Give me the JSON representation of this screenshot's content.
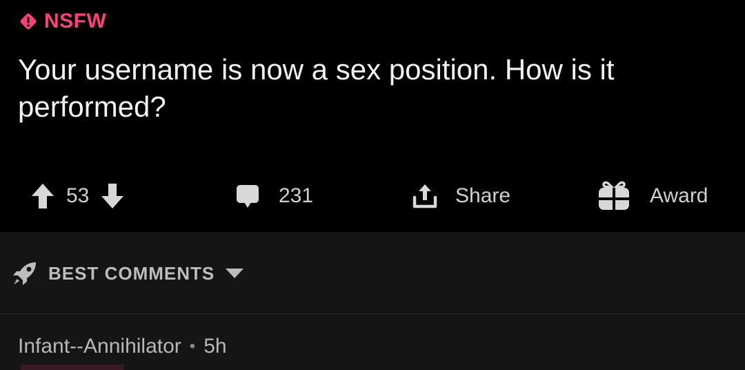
{
  "post": {
    "nsfw_label": "NSFW",
    "title": "Your username is now a sex position. How is it performed?",
    "nsfw_icon": "nsfw-diamond-icon"
  },
  "actions": {
    "vote_count": "53",
    "comment_count": "231",
    "share_label": "Share",
    "award_label": "Award",
    "icons": [
      "upvote-arrow-icon",
      "downvote-arrow-icon",
      "comment-bubble-icon",
      "share-icon",
      "gift-icon"
    ]
  },
  "comments_sort": {
    "label": "BEST COMMENTS",
    "icons": [
      "rocket-icon",
      "caret-down-icon"
    ]
  },
  "comment": {
    "author": "Infant--Annihilator",
    "separator": "•",
    "age": "5h"
  },
  "colors": {
    "background": "#000000",
    "nsfw_accent": "#ff3f7c",
    "panel": "#151515",
    "text": "#e8e8e8",
    "muted": "#b8b8b8"
  }
}
